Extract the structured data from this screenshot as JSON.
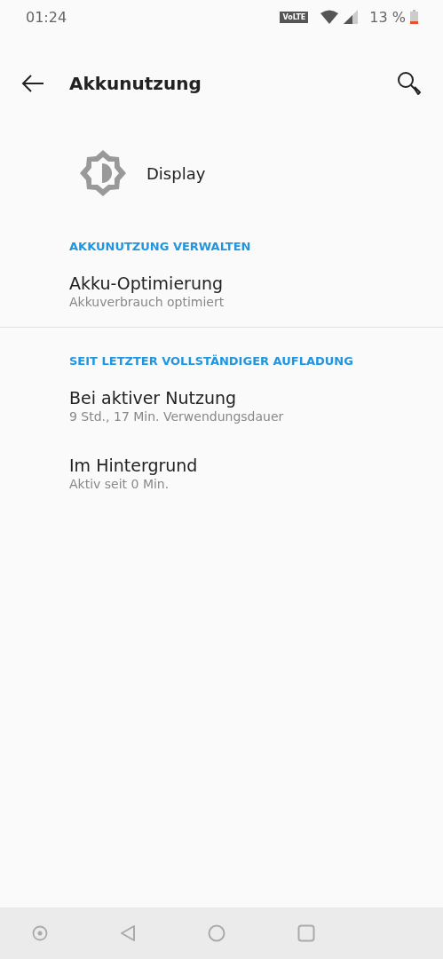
{
  "status_bar": {
    "time": "01:24",
    "volte": "VoLTE",
    "battery": "13 %"
  },
  "toolbar": {
    "title": "Akkunutzung"
  },
  "app": {
    "name": "Display"
  },
  "sections": [
    {
      "header": "AKKUNUTZUNG VERWALTEN",
      "divider": true,
      "items": [
        {
          "title": "Akku-Optimierung",
          "summary": "Akkuverbrauch optimiert"
        }
      ]
    },
    {
      "header": "SEIT LETZTER VOLLSTÄNDIGER AUFLADUNG",
      "divider": false,
      "items": [
        {
          "title": "Bei aktiver Nutzung",
          "summary": "9 Std., 17 Min. Verwendungsdauer"
        },
        {
          "title": "Im Hintergrund",
          "summary": "Aktiv seit 0 Min."
        }
      ]
    }
  ]
}
